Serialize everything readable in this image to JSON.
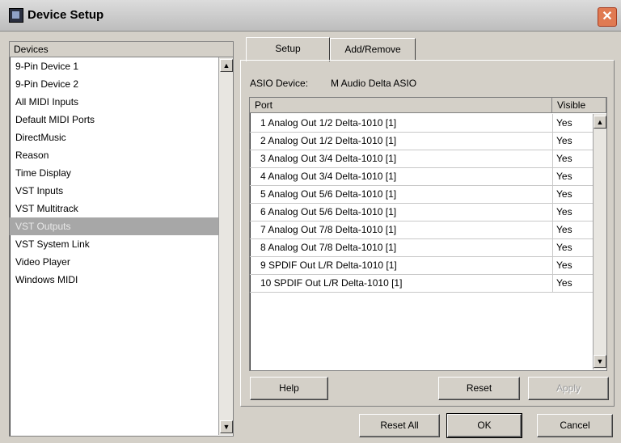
{
  "window": {
    "title": "Device Setup",
    "close_glyph": "✕"
  },
  "devices": {
    "header": "Devices",
    "items": [
      {
        "label": "9-Pin Device 1"
      },
      {
        "label": "9-Pin Device 2"
      },
      {
        "label": "All MIDI Inputs"
      },
      {
        "label": "Default MIDI Ports"
      },
      {
        "label": "DirectMusic"
      },
      {
        "label": "Reason"
      },
      {
        "label": "Time Display"
      },
      {
        "label": "VST Inputs"
      },
      {
        "label": "VST Multitrack"
      },
      {
        "label": "VST Outputs",
        "selected": true
      },
      {
        "label": "VST System Link"
      },
      {
        "label": "Video Player"
      },
      {
        "label": "Windows MIDI"
      }
    ]
  },
  "tabs": [
    {
      "label": "Setup",
      "active": true
    },
    {
      "label": "Add/Remove",
      "active": false
    }
  ],
  "asio": {
    "label": "ASIO Device:",
    "value": "M Audio Delta ASIO"
  },
  "ports_table": {
    "columns": [
      "Port",
      "Visible"
    ],
    "rows": [
      {
        "port": "1 Analog Out 1/2 Delta-1010 [1]",
        "visible": "Yes"
      },
      {
        "port": "2 Analog Out 1/2 Delta-1010 [1]",
        "visible": "Yes"
      },
      {
        "port": "3 Analog Out 3/4 Delta-1010 [1]",
        "visible": "Yes"
      },
      {
        "port": "4 Analog Out 3/4 Delta-1010 [1]",
        "visible": "Yes"
      },
      {
        "port": "5 Analog Out 5/6 Delta-1010 [1]",
        "visible": "Yes"
      },
      {
        "port": "6 Analog Out 5/6 Delta-1010 [1]",
        "visible": "Yes"
      },
      {
        "port": "7 Analog Out 7/8 Delta-1010 [1]",
        "visible": "Yes"
      },
      {
        "port": "8 Analog Out 7/8 Delta-1010 [1]",
        "visible": "Yes"
      },
      {
        "port": "9 SPDIF Out L/R Delta-1010 [1]",
        "visible": "Yes"
      },
      {
        "port": "10 SPDIF Out L/R Delta-1010 [1]",
        "visible": "Yes"
      }
    ]
  },
  "panel_buttons": {
    "help": "Help",
    "reset": "Reset",
    "apply": "Apply"
  },
  "dialog_buttons": {
    "reset_all": "Reset All",
    "ok": "OK",
    "cancel": "Cancel"
  },
  "scroll_glyphs": {
    "up": "▲",
    "down": "▼"
  }
}
